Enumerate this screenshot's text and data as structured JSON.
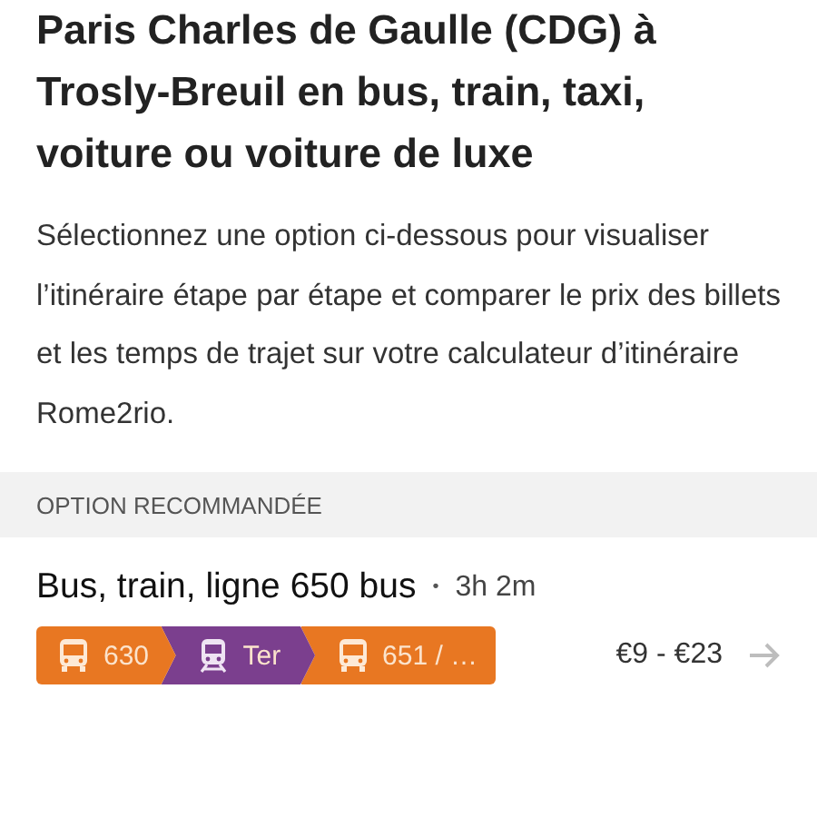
{
  "title": "Paris Charles de Gaulle (CDG) à Trosly-Breuil en bus, train, taxi, voiture ou voiture de luxe",
  "description": "Sélectionnez une option ci-dessous pour visualiser l’itinéraire étape par étape et comparer le prix des billets et les temps de trajet sur votre calculateur d’itinéraire Rome2rio.",
  "section_label": "OPTION RECOMMANDÉE",
  "route": {
    "name": "Bus, train, ligne 650 bus",
    "separator": "•",
    "duration": "3h 2m",
    "price": "€9 - €23",
    "segments": [
      {
        "kind": "bus",
        "label": "630",
        "color": "#e87722"
      },
      {
        "kind": "train",
        "label": "Ter",
        "color": "#7b3f8e"
      },
      {
        "kind": "bus",
        "label": "651 / …",
        "color": "#e87722"
      }
    ]
  }
}
